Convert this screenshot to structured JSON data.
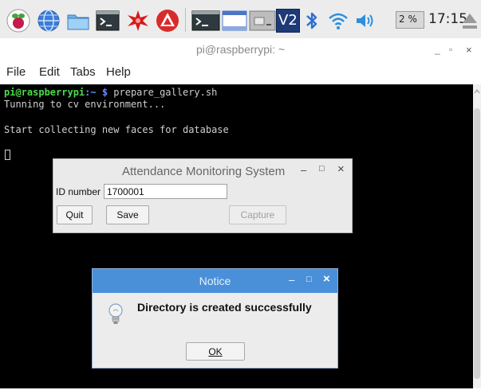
{
  "taskbar": {
    "icons": [
      "raspberry-menu-icon",
      "web-browser-icon",
      "file-manager-icon",
      "terminal-icon",
      "wolfram-icon",
      "mathematica-icon"
    ],
    "windows": [
      "terminal-window-button",
      "blank-window-button",
      "minimized-window-button"
    ],
    "tray": {
      "vnc_label": "V2",
      "cpu_label": "2 %",
      "time": "17:15"
    }
  },
  "terminal": {
    "title": "pi@raspberrypi: ~",
    "menu": [
      "File",
      "Edit",
      "Tabs",
      "Help"
    ],
    "prompt_user": "pi@raspberrypi",
    "prompt_path": ":~ $",
    "command": " prepare_gallery.sh",
    "line2": "Tunning to cv environment...",
    "line3": "Start collecting new faces for database"
  },
  "attendance_window": {
    "title": "Attendance Monitoring System",
    "id_label": "ID number",
    "id_value": "1700001",
    "quit": "Quit",
    "save": "Save",
    "capture": "Capture"
  },
  "notice": {
    "title": "Notice",
    "message": "Directory is created successfully",
    "ok_label": "OK"
  },
  "colors": {
    "terminal_bg": "#000000",
    "prompt_green": "#4cd94c",
    "prompt_blue": "#6b8cff",
    "notice_titlebar": "#4a90d9",
    "taskbar_bg": "#ececec"
  }
}
